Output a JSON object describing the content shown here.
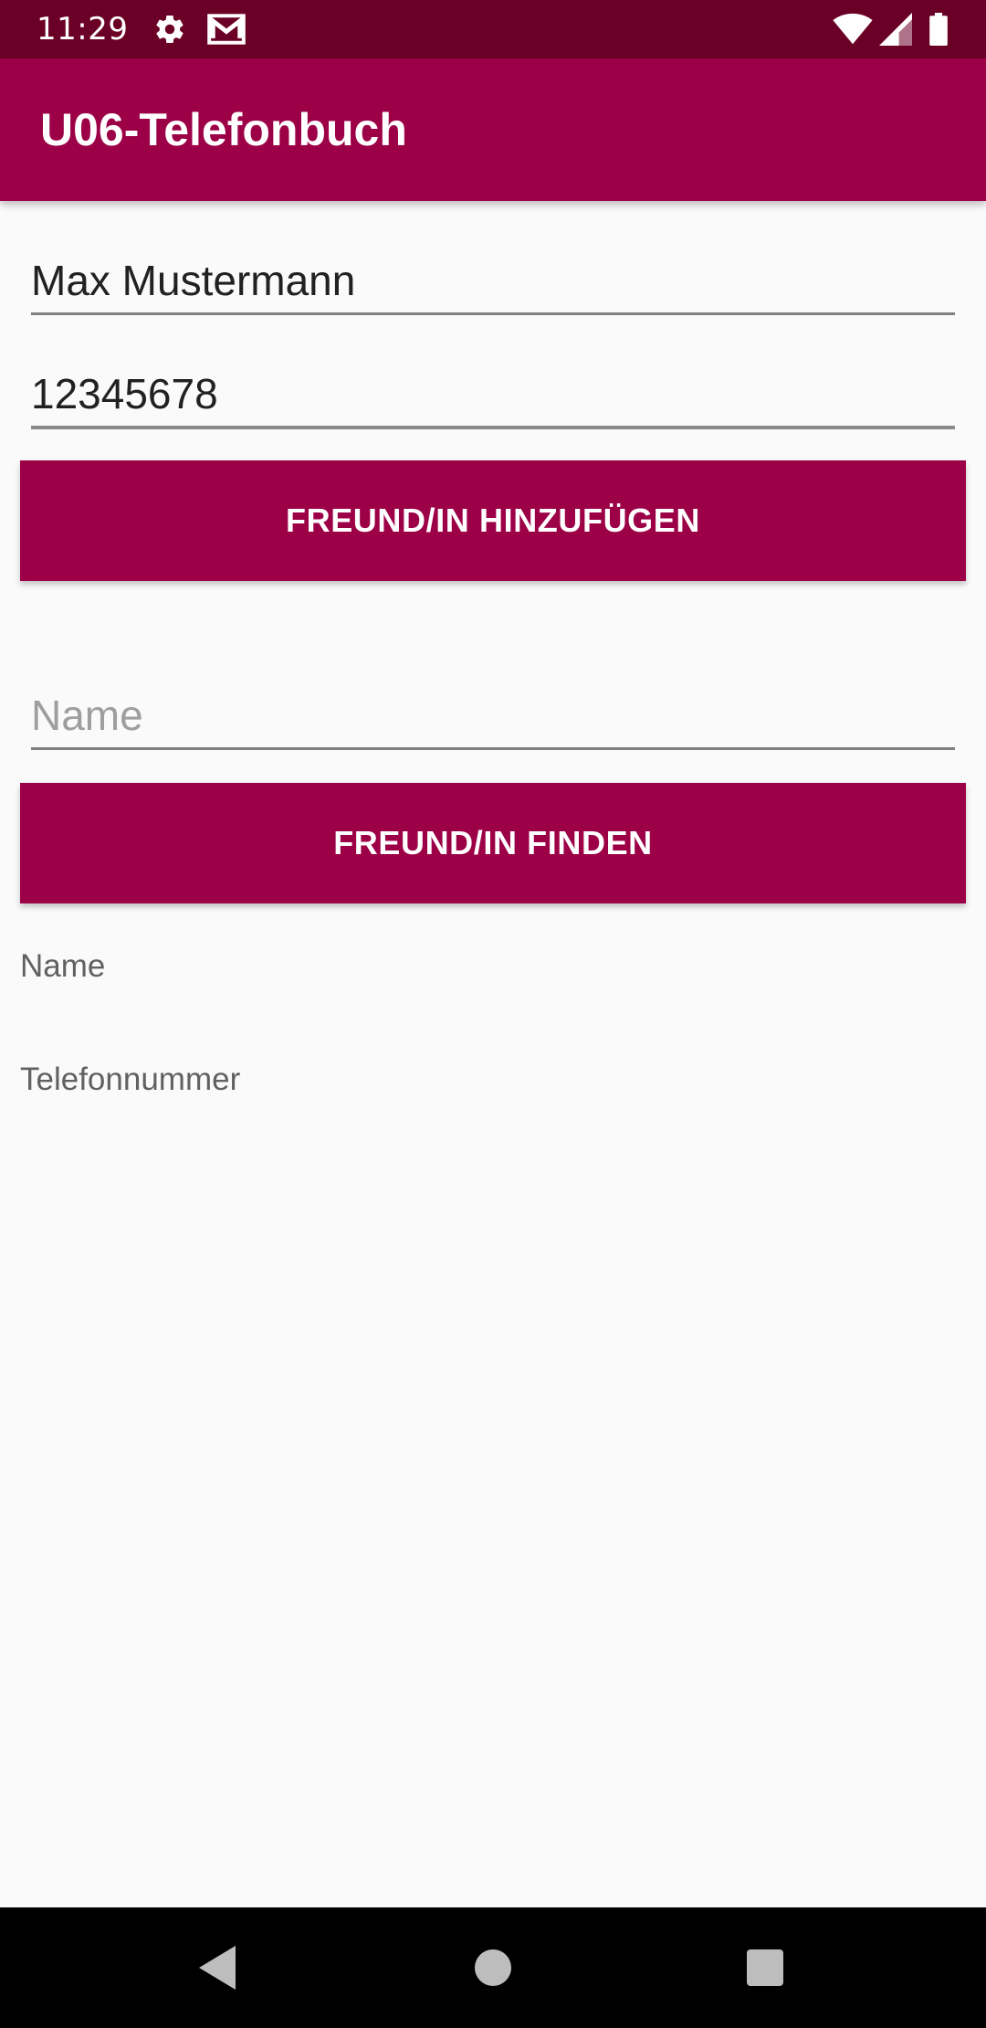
{
  "status_bar": {
    "time": "11:29",
    "icons_left": [
      "gear-icon",
      "gmail-icon"
    ],
    "icons_right": [
      "wifi-icon",
      "cellular-signal-icon",
      "battery-icon"
    ],
    "background": "#6b0026"
  },
  "app_bar": {
    "title": "U06-Telefonbuch",
    "background": "#9c0047"
  },
  "add_form": {
    "name_value": "Max Mustermann",
    "phone_value": "12345678",
    "add_button_label": "FREUND/IN HINZUFÜGEN"
  },
  "search_form": {
    "name_placeholder": "Name",
    "find_button_label": "FREUND/IN FINDEN"
  },
  "results": {
    "name_label": "Name",
    "phone_label": "Telefonnummer"
  },
  "nav_bar": {
    "buttons": [
      "back-icon",
      "home-icon",
      "recents-icon"
    ]
  },
  "colors": {
    "accent": "#9c0047",
    "status_bar": "#6b0026",
    "background": "#fafafa"
  }
}
